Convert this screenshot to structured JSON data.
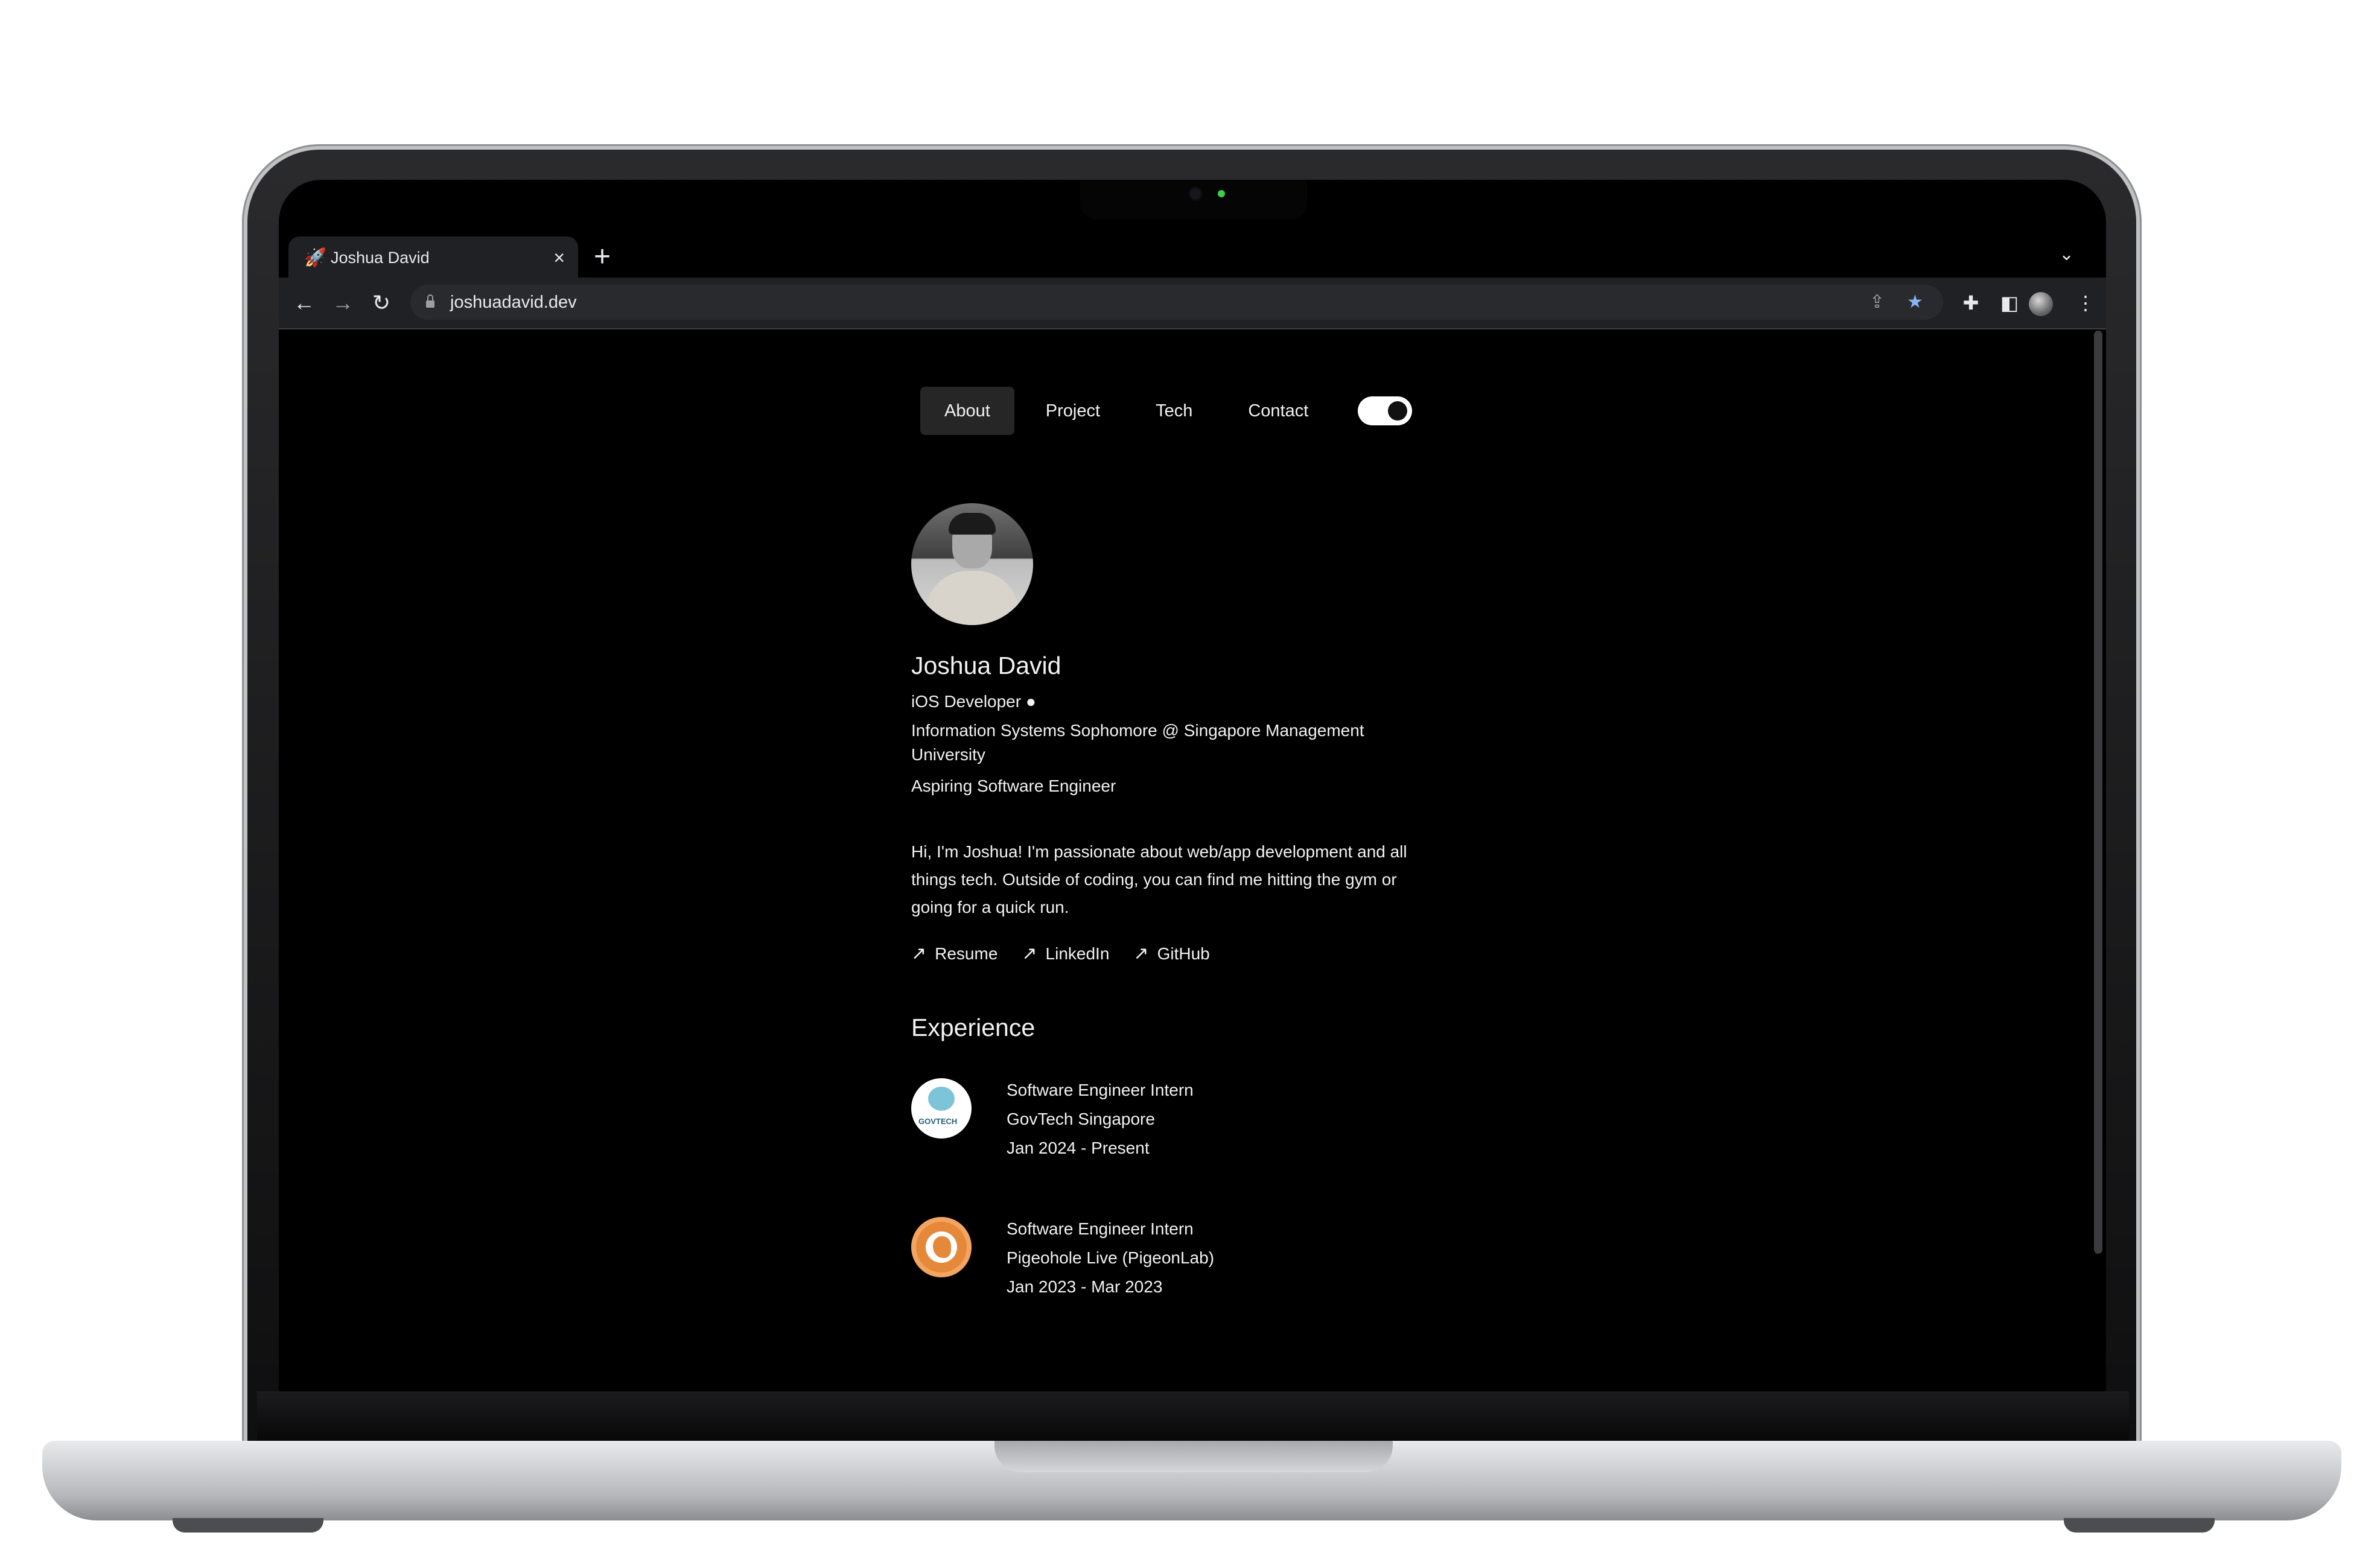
{
  "browser": {
    "tab_title": "Joshua David",
    "url": "joshuadavid.dev",
    "new_tab_label": "+",
    "close_label": "×"
  },
  "nav": {
    "items": [
      "About",
      "Project",
      "Tech",
      "Contact"
    ],
    "active": "About",
    "dark_mode": true
  },
  "profile": {
    "name": "Joshua David",
    "role": "iOS Developer ",
    "education": "Information Systems Sophomore @ Singapore Management University",
    "aspiration": "Aspiring Software Engineer",
    "bio": "Hi, I'm Joshua! I'm passionate about web/app development and all things tech. Outside of coding, you can find me hitting the gym or going for a quick run."
  },
  "links": [
    {
      "label": "Resume",
      "icon": "arrow-up-right-icon"
    },
    {
      "label": "LinkedIn",
      "icon": "arrow-up-right-icon"
    },
    {
      "label": "GitHub",
      "icon": "arrow-up-right-icon"
    }
  ],
  "experience": {
    "title": "Experience",
    "items": [
      {
        "role": "Software Engineer Intern",
        "company": "GovTech Singapore",
        "dates": "Jan 2024 - Present",
        "logo_text": "GOVTECH"
      },
      {
        "role": "Software Engineer Intern",
        "company": "Pigeohole Live (PigeonLab)",
        "dates": "Jan 2023 - Mar 2023"
      }
    ]
  },
  "colors": {
    "page_bg": "#000000",
    "text": "#f2f2f2",
    "active_nav_bg": "#262626",
    "bookmark_star": "#8ab4f8",
    "pigeon_orange": "#e6883a"
  }
}
